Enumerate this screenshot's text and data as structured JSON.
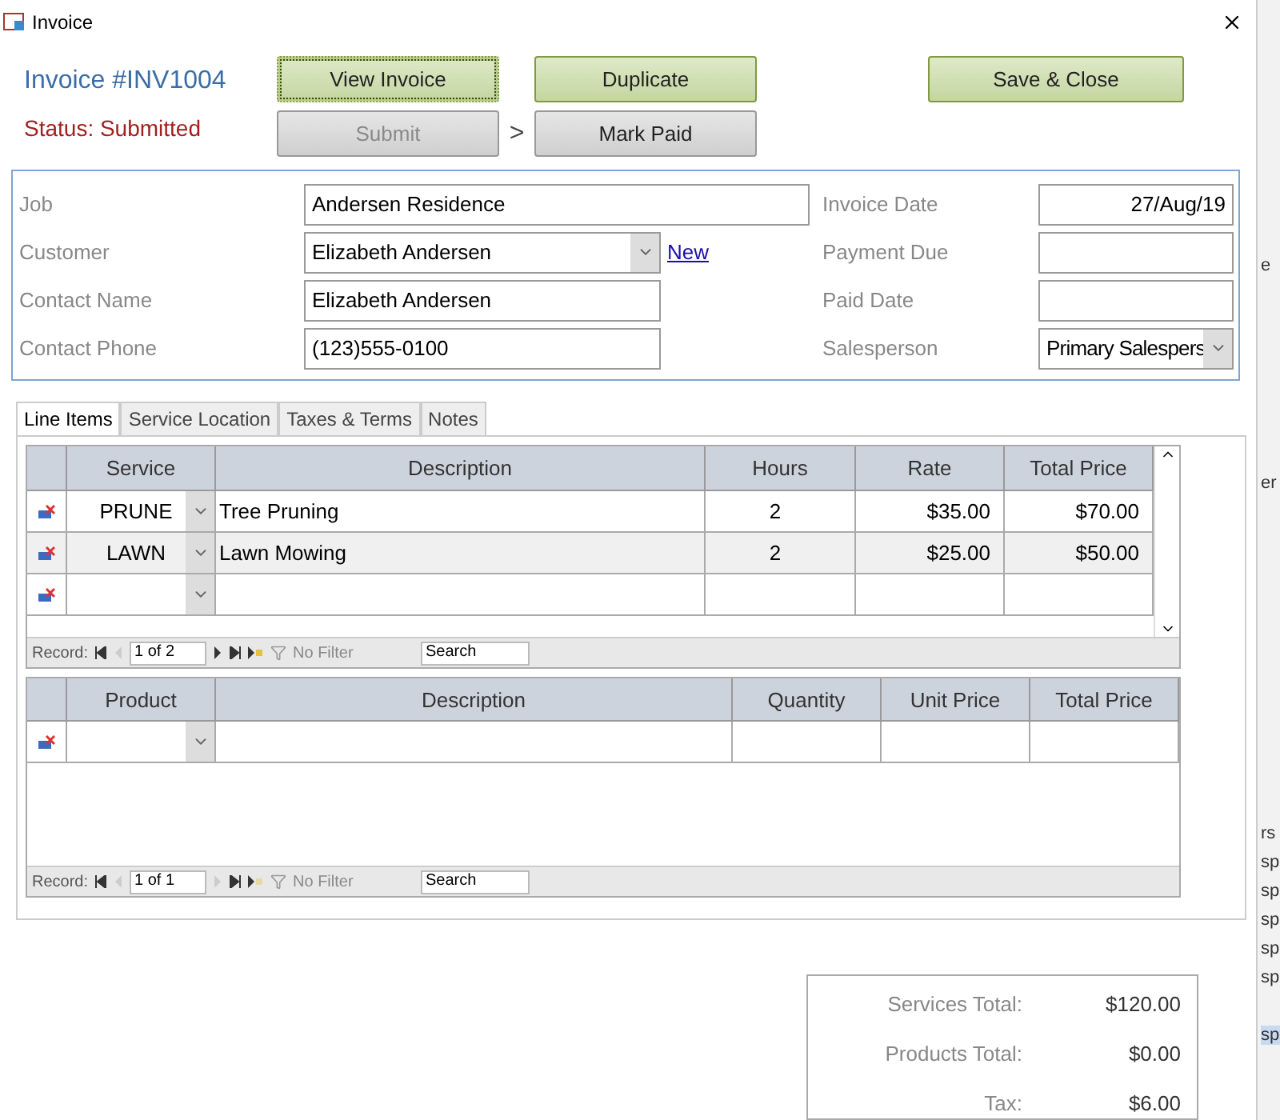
{
  "window": {
    "title": "Invoice"
  },
  "header": {
    "invoice_title": "Invoice #INV1004",
    "status": "Status: Submitted",
    "step_arrow": ">",
    "buttons": [
      {
        "label": "View Invoice",
        "kind": "green",
        "disabled": false,
        "focused": true
      },
      {
        "label": "Duplicate",
        "kind": "green",
        "disabled": false,
        "focused": false
      },
      {
        "label": "Save & Close",
        "kind": "green",
        "disabled": false,
        "focused": false
      },
      {
        "label": "Submit",
        "kind": "gray",
        "disabled": true,
        "focused": false
      },
      {
        "label": "Mark Paid",
        "kind": "gray",
        "disabled": false,
        "focused": false
      }
    ]
  },
  "form": {
    "left": [
      {
        "label": "Job",
        "value": "Andersen Residence",
        "kind": "wide"
      },
      {
        "label": "Customer",
        "value": "Elizabeth Andersen",
        "kind": "combo",
        "link": "New"
      },
      {
        "label": "Contact Name",
        "value": "Elizabeth Andersen",
        "kind": "text"
      },
      {
        "label": "Contact Phone",
        "value": "(123)555-0100",
        "kind": "text"
      }
    ],
    "right": [
      {
        "label": "Invoice Date",
        "value": "27/Aug/19",
        "kind": "date"
      },
      {
        "label": "Payment Due",
        "kind": "date"
      },
      {
        "label": "Paid Date",
        "kind": "date"
      },
      {
        "label": "Salesperson",
        "value": "Primary Salespers",
        "kind": "combo"
      }
    ]
  },
  "tabs": [
    {
      "label": "Line Items",
      "selected": true
    },
    {
      "label": "Service Location",
      "selected": false
    },
    {
      "label": "Taxes & Terms",
      "selected": false
    },
    {
      "label": "Notes",
      "selected": false
    }
  ],
  "services": {
    "columns": [
      "Service",
      "Description",
      "Hours",
      "Rate",
      "Total Price"
    ],
    "rows": [
      {
        "service": "PRUNE",
        "description": "Tree Pruning",
        "hours": "2",
        "rate": "$35.00",
        "total": "$70.00"
      },
      {
        "service": "LAWN",
        "description": "Lawn Mowing",
        "hours": "2",
        "rate": "$25.00",
        "total": "$50.00"
      }
    ],
    "nav": {
      "label": "Record:",
      "position": "1 of 2",
      "filter": "No Filter",
      "search": "Search"
    }
  },
  "products": {
    "columns": [
      "Product",
      "Description",
      "Quantity",
      "Unit Price",
      "Total Price"
    ],
    "nav": {
      "label": "Record:",
      "position": "1 of 1",
      "filter": "No Filter",
      "search": "Search"
    }
  },
  "totals": [
    {
      "label": "Services Total:",
      "value": "$120.00"
    },
    {
      "label": "Products Total:",
      "value": "$0.00"
    },
    {
      "label": "Tax:",
      "value": "$6.00"
    }
  ],
  "background_window": {
    "fragments": [
      {
        "text": "e",
        "selected": false
      },
      {
        "text": "er",
        "selected": false
      },
      {
        "text": "rs",
        "selected": false
      },
      {
        "text": "sp",
        "selected": false
      },
      {
        "text": "sp",
        "selected": false
      },
      {
        "text": "sp",
        "selected": false
      },
      {
        "text": "sp",
        "selected": false
      },
      {
        "text": "sp",
        "selected": false
      },
      {
        "text": "sp",
        "selected": true
      }
    ]
  }
}
